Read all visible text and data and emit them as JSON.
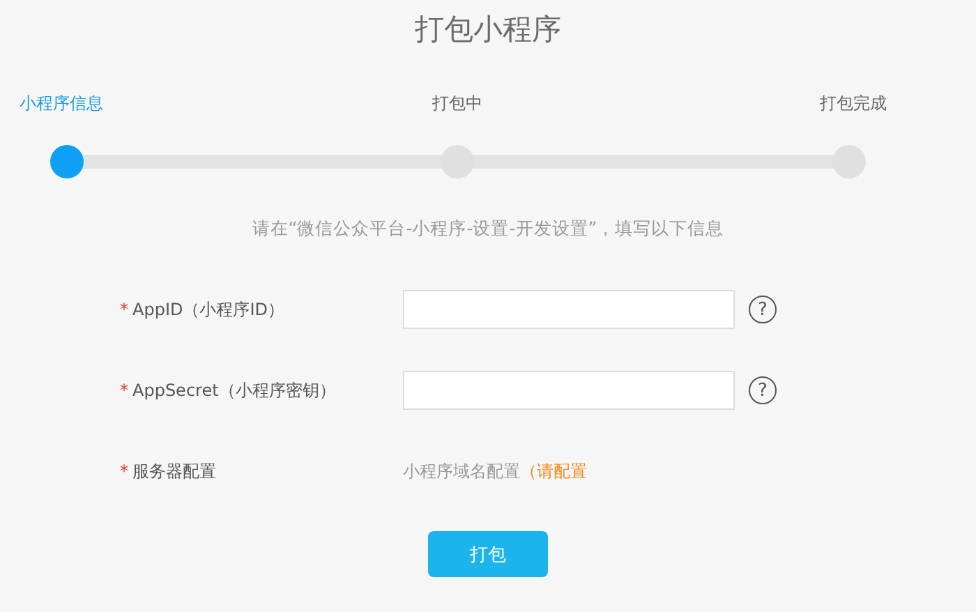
{
  "title": "打包小程序",
  "steps": [
    {
      "label": "小程序信息",
      "active": true
    },
    {
      "label": "打包中",
      "active": false
    },
    {
      "label": "打包完成",
      "active": false
    }
  ],
  "instruction": "请在“微信公众平台-小程序-设置-开发设置”，填写以下信息",
  "fields": [
    {
      "kind": "input",
      "required_mark": "*",
      "label": "AppID（小程序ID）",
      "help": "?"
    },
    {
      "kind": "input",
      "required_mark": "*",
      "label": "AppSecret（小程序密钥）",
      "help": "?"
    },
    {
      "kind": "text",
      "required_mark": "*",
      "label": "服务器配置",
      "value": "小程序域名配置",
      "link": "（请配置"
    }
  ],
  "button": "打包"
}
